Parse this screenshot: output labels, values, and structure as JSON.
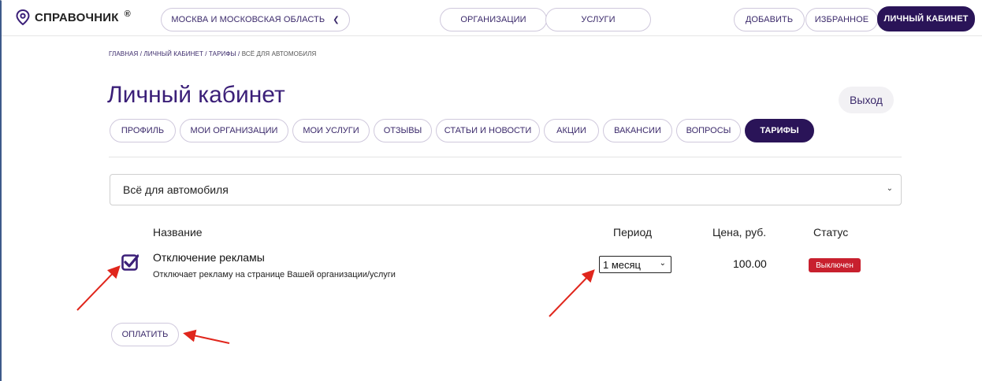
{
  "header": {
    "logo": "СПРАВОЧНИК",
    "logo_mark": "®",
    "region": "МОСКВА И МОСКОВСКАЯ ОБЛАСТЬ",
    "organizations": "ОРГАНИЗАЦИИ",
    "services": "УСЛУГИ",
    "add": "ДОБАВИТЬ",
    "favorites": "ИЗБРАННОЕ",
    "cabinet": "ЛИЧНЫЙ КАБИНЕТ"
  },
  "breadcrumb": {
    "home": "ГЛАВНАЯ",
    "sep1": " / ",
    "cabinet": "ЛИЧНЫЙ КАБИНЕТ",
    "sep2": " / ",
    "tariffs": "ТАРИФЫ",
    "sep3": " / ",
    "current": "ВСЁ ДЛЯ АВТОМОБИЛЯ"
  },
  "page": {
    "title": "Личный кабинет",
    "logout": "Выход"
  },
  "tabs": [
    {
      "label": "ПРОФИЛЬ"
    },
    {
      "label": "МОИ ОРГАНИЗАЦИИ"
    },
    {
      "label": "МОИ УСЛУГИ"
    },
    {
      "label": "ОТЗЫВЫ"
    },
    {
      "label": "СТАТЬИ И НОВОСТИ"
    },
    {
      "label": "АКЦИИ"
    },
    {
      "label": "ВАКАНСИИ"
    },
    {
      "label": "ВОПРОСЫ"
    },
    {
      "label": "ТАРИФЫ",
      "active": true
    }
  ],
  "category_select": {
    "value": "Всё для автомобиля"
  },
  "table": {
    "headers": {
      "name": "Название",
      "period": "Период",
      "price": "Цена, руб.",
      "status": "Статус"
    },
    "rows": [
      {
        "checked": true,
        "name": "Отключение рекламы",
        "description": "Отключает рекламу на странице Вашей организации/услуги",
        "period": "1 месяц",
        "price": "100.00",
        "status": "Выключен"
      }
    ]
  },
  "pay_button": "ОПЛАТИТЬ",
  "colors": {
    "brand_dark": "#2a1458",
    "accent_text": "#3b1f78",
    "status_off": "#c8202e",
    "checkbox": "#3b1f78",
    "annotation_arrow": "#e0261c"
  },
  "icons": [
    "location-pin-icon",
    "chevron-down-icon",
    "checkbox-checked-icon",
    "annotation-arrow-icon"
  ]
}
